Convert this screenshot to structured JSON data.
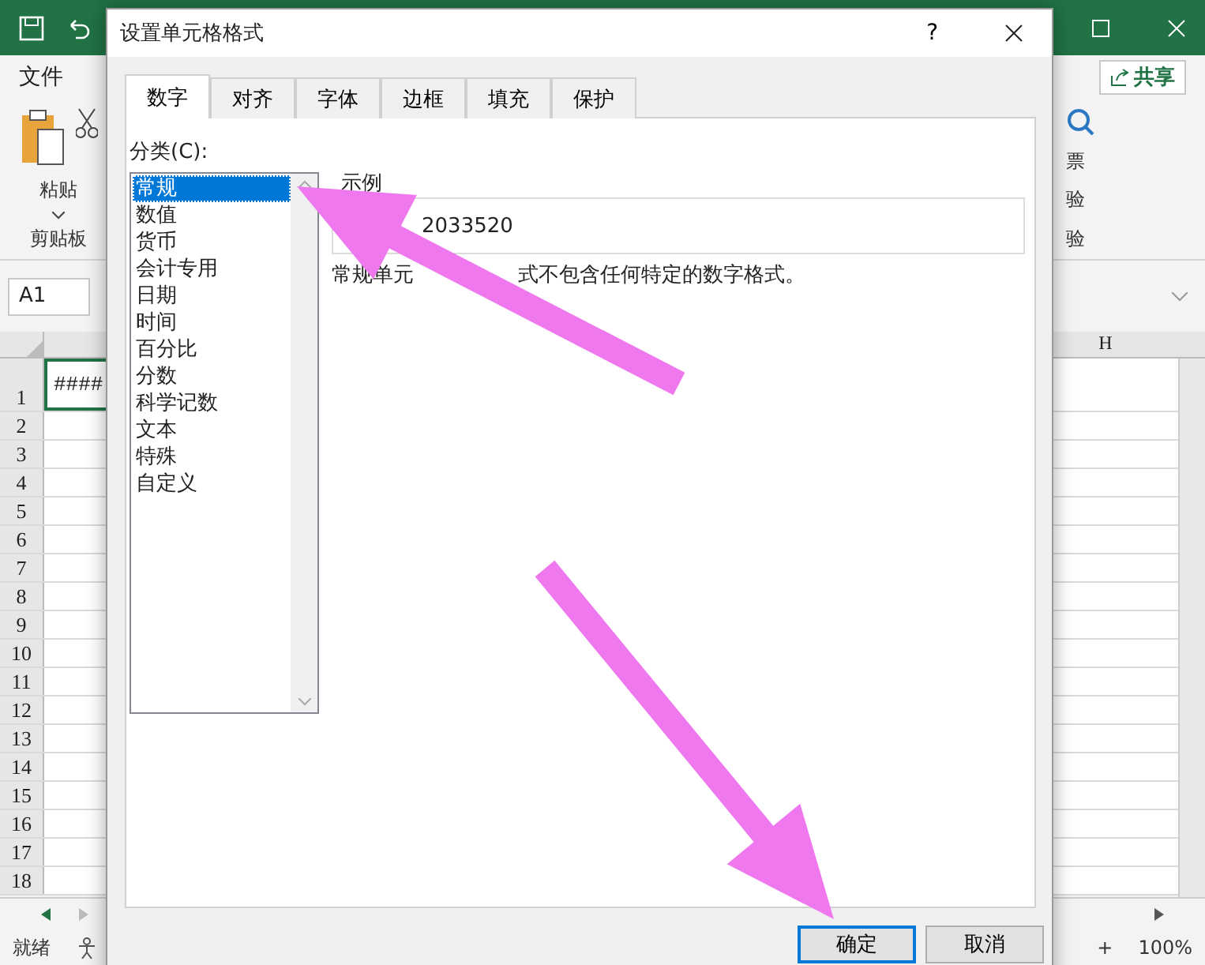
{
  "excel": {
    "file_tab": "文件",
    "share_button": "共享",
    "paste": "粘贴",
    "clipboard_group": "剪贴板",
    "right_group_line_1": "票",
    "right_group_line_2": "验",
    "right_group_label": "验",
    "name_box": "A1",
    "column_header": "H",
    "cell_a1": "####",
    "rows": [
      "1",
      "2",
      "3",
      "4",
      "5",
      "6",
      "7",
      "8",
      "9",
      "10",
      "11",
      "12",
      "13",
      "14",
      "15",
      "16",
      "17",
      "18"
    ],
    "status": "就绪",
    "zoom_plus": "+",
    "zoom": "100%"
  },
  "dialog": {
    "title": "设置单元格格式",
    "help": "?",
    "tabs": [
      {
        "label": "数字",
        "selected": true
      },
      {
        "label": "对齐",
        "selected": false
      },
      {
        "label": "字体",
        "selected": false
      },
      {
        "label": "边框",
        "selected": false
      },
      {
        "label": "填充",
        "selected": false
      },
      {
        "label": "保护",
        "selected": false
      }
    ],
    "category_label": "分类(C):",
    "categories": [
      {
        "label": "常规",
        "selected": true
      },
      {
        "label": "数值",
        "selected": false
      },
      {
        "label": "货币",
        "selected": false
      },
      {
        "label": "会计专用",
        "selected": false
      },
      {
        "label": "日期",
        "selected": false
      },
      {
        "label": "时间",
        "selected": false
      },
      {
        "label": "百分比",
        "selected": false
      },
      {
        "label": "分数",
        "selected": false
      },
      {
        "label": "科学记数",
        "selected": false
      },
      {
        "label": "文本",
        "selected": false
      },
      {
        "label": "特殊",
        "selected": false
      },
      {
        "label": "自定义",
        "selected": false
      }
    ],
    "sample_label": "示例",
    "sample_value": "2033520",
    "description_parts": [
      "常规单元",
      "式不包含任何特定的数字格式。"
    ],
    "buttons": [
      {
        "label": "确定",
        "focused": true
      },
      {
        "label": "取消",
        "focused": false
      }
    ]
  }
}
